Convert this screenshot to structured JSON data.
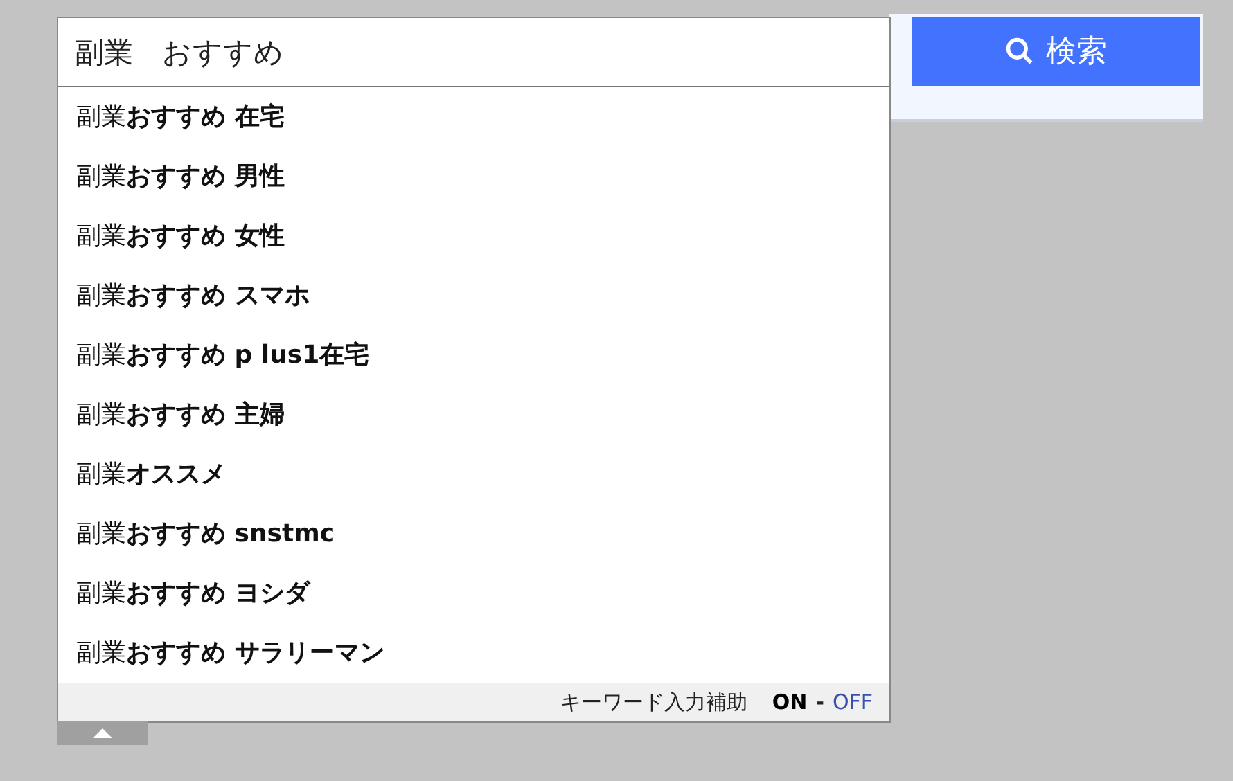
{
  "search": {
    "value": "副業　おすすめ",
    "button": "検索"
  },
  "suggestions": [
    {
      "prefix": "副業",
      "completion": "おすすめ 在宅"
    },
    {
      "prefix": "副業",
      "completion": "おすすめ 男性"
    },
    {
      "prefix": "副業",
      "completion": "おすすめ 女性"
    },
    {
      "prefix": "副業",
      "completion": "おすすめ スマホ"
    },
    {
      "prefix": "副業",
      "completion": "おすすめ p lus1在宅"
    },
    {
      "prefix": "副業",
      "completion": "おすすめ 主婦"
    },
    {
      "prefix": "副業",
      "completion": "オススメ"
    },
    {
      "prefix": "副業",
      "completion": "おすすめ snstmc"
    },
    {
      "prefix": "副業",
      "completion": "おすすめ ヨシダ"
    },
    {
      "prefix": "副業",
      "completion": "おすすめ サラリーマン"
    }
  ],
  "assist": {
    "label": "キーワード入力補助",
    "on_label": "ON",
    "separator": "-",
    "off_label": "OFF",
    "on": true
  }
}
